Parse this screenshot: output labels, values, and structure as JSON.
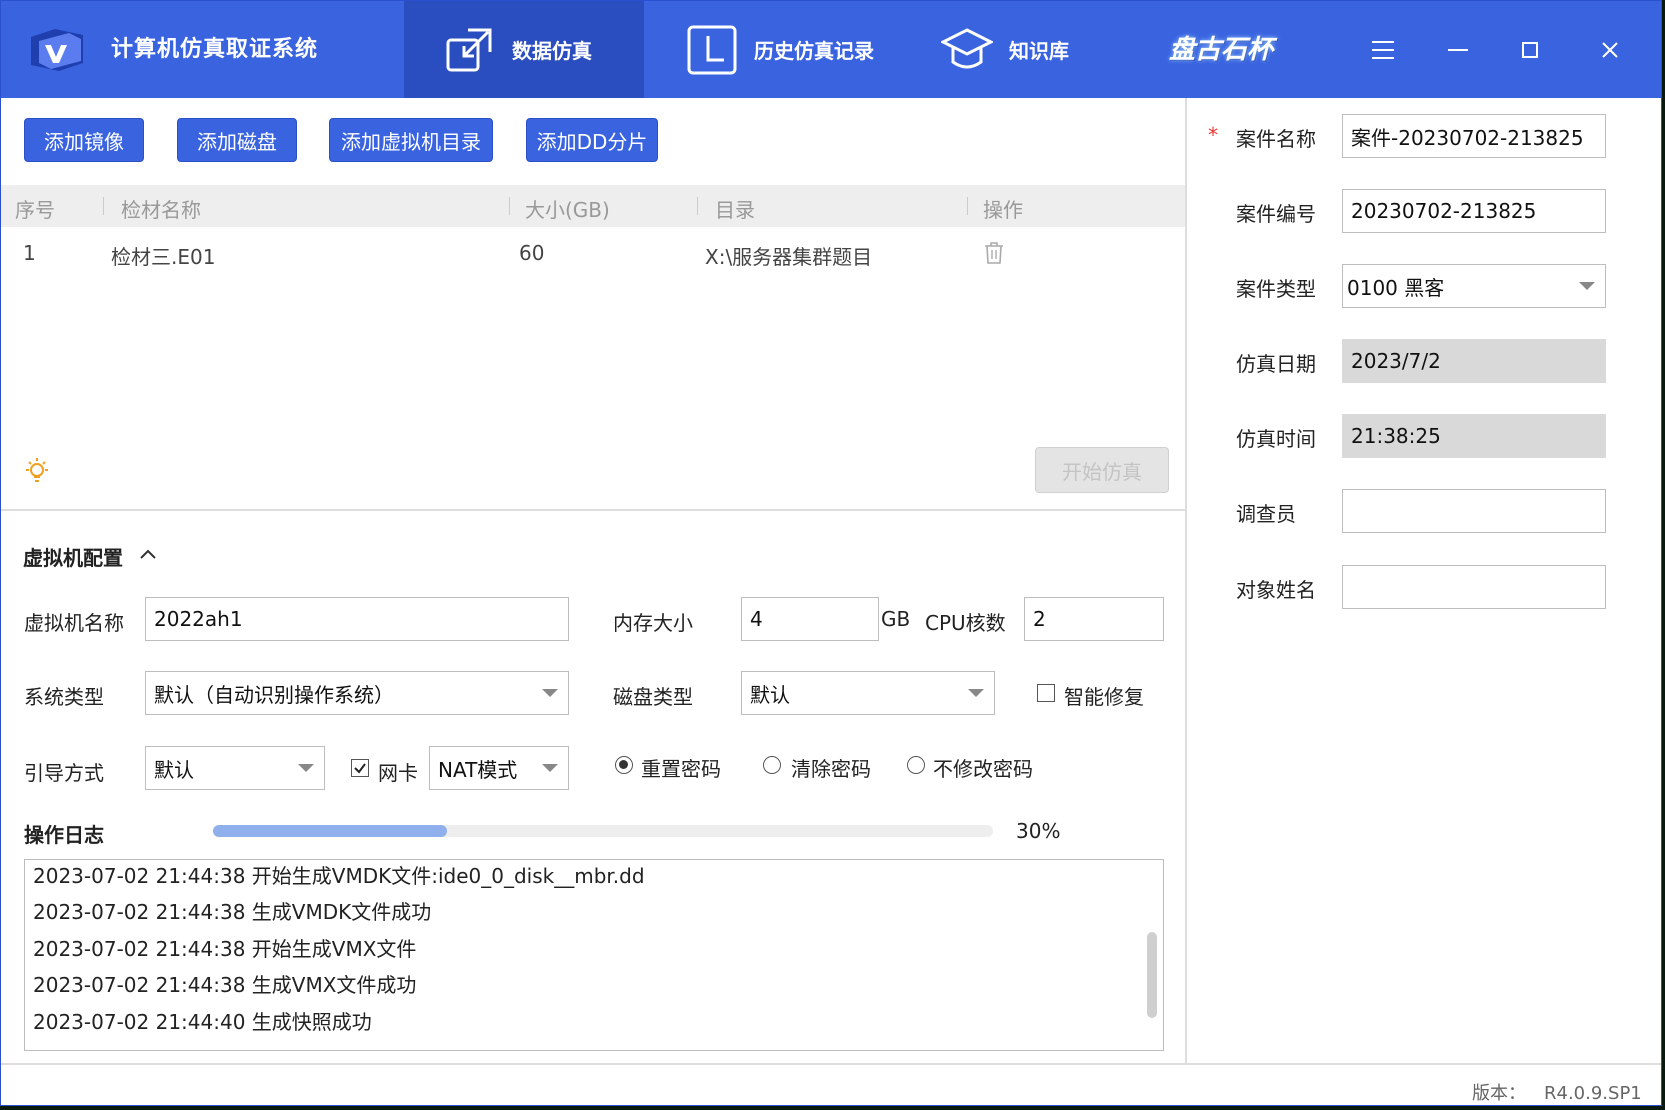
{
  "app": {
    "title": "计算机仿真取证系统",
    "nav": [
      {
        "label": "数据仿真",
        "icon": "external-window-icon",
        "active": true
      },
      {
        "label": "历史仿真记录",
        "icon": "clock-square-icon",
        "active": false
      },
      {
        "label": "知识库",
        "icon": "graduation-cap-icon",
        "active": false
      }
    ],
    "brand": "盘古石杯"
  },
  "toolbar": {
    "add_image": "添加镜像",
    "add_disk": "添加磁盘",
    "add_vm_dir": "添加虚拟机目录",
    "add_dd": "添加DD分片"
  },
  "table": {
    "headers": [
      "序号",
      "检材名称",
      "大小(GB)",
      "目录",
      "操作"
    ],
    "rows": [
      {
        "index": "1",
        "name": "检材三.E01",
        "size": "60",
        "dir": "X:\\服务器集群题目"
      }
    ]
  },
  "start_button": "开始仿真",
  "vm_config": {
    "title": "虚拟机配置",
    "vm_name_label": "虚拟机名称",
    "vm_name": "2022ah1",
    "memory_label": "内存大小",
    "memory": "4",
    "memory_unit": "GB",
    "cpu_label": "CPU核数",
    "cpu": "2",
    "os_type_label": "系统类型",
    "os_type": "默认（自动识别操作系统）",
    "disk_type_label": "磁盘类型",
    "disk_type": "默认",
    "smart_repair_label": "智能修复",
    "smart_repair_checked": false,
    "boot_label": "引导方式",
    "boot": "默认",
    "nic_label": "网卡",
    "nic_checked": true,
    "nic_mode": "NAT模式",
    "password_options": [
      "重置密码",
      "清除密码",
      "不修改密码"
    ],
    "password_selected": 0
  },
  "log": {
    "title": "操作日志",
    "progress": 30,
    "progress_text": "30%",
    "lines": [
      "2023-07-02 21:44:38 开始生成VMDK文件:ide0_0_disk__mbr.dd",
      "2023-07-02 21:44:38 生成VMDK文件成功",
      "2023-07-02 21:44:38 开始生成VMX文件",
      "2023-07-02 21:44:38 生成VMX文件成功",
      "2023-07-02 21:44:40 生成快照成功"
    ]
  },
  "case": {
    "required_mark": "*",
    "name_label": "案件名称",
    "name": "案件-20230702-213825",
    "number_label": "案件编号",
    "number": "20230702-213825",
    "type_label": "案件类型",
    "type": "0100 黑客",
    "date_label": "仿真日期",
    "date": "2023/7/2",
    "time_label": "仿真时间",
    "time": "21:38:25",
    "investigator_label": "调查员",
    "investigator": "",
    "subject_label": "对象姓名",
    "subject": ""
  },
  "version": {
    "label": "版本：",
    "value": "R4.0.9.SP1"
  },
  "colors": {
    "header": "#3a63e0",
    "header_active": "#2a4dbf",
    "button": "#3a63e0",
    "progress_fill": "#8fb0ec",
    "required": "#e33333"
  }
}
